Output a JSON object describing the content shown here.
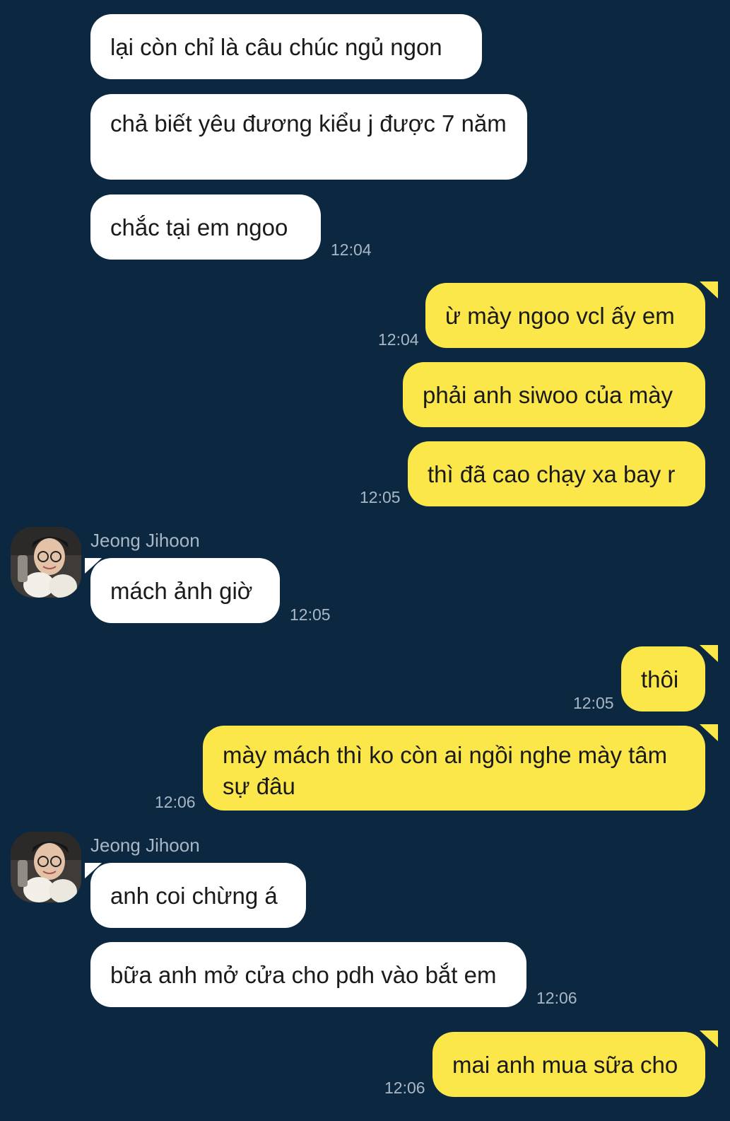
{
  "contact": {
    "name": "Jeong Jihoon"
  },
  "colors": {
    "background": "#0b2840",
    "incoming": "#ffffff",
    "outgoing": "#fbe74a",
    "timestamp": "#a9b7c4"
  },
  "messages": [
    {
      "from": "contact",
      "text": "lại còn chỉ là câu chúc ngủ ngon"
    },
    {
      "from": "contact",
      "text": "chả biết yêu đương kiểu j được 7 năm"
    },
    {
      "from": "contact",
      "text": "chắc tại em ngoo",
      "time": "12:04"
    },
    {
      "from": "me",
      "text": "ừ mày ngoo vcl ấy em",
      "time": "12:04"
    },
    {
      "from": "me",
      "text": "phải anh siwoo của mày"
    },
    {
      "from": "me",
      "text": "thì đã cao chạy xa bay r",
      "time": "12:05"
    },
    {
      "from": "contact",
      "text": "mách ảnh giờ",
      "time": "12:05"
    },
    {
      "from": "me",
      "text": "thôi",
      "time": "12:05"
    },
    {
      "from": "me",
      "text": "mày mách thì ko còn ai ngồi nghe mày tâm sự đâu",
      "time": "12:06"
    },
    {
      "from": "contact",
      "text": "anh coi chừng á"
    },
    {
      "from": "contact",
      "text": "bữa anh mở cửa cho pdh vào bắt em",
      "time": "12:06"
    },
    {
      "from": "me",
      "text": "mai anh mua sữa cho",
      "time": "12:06"
    }
  ]
}
